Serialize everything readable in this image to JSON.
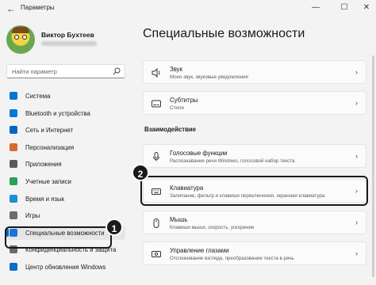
{
  "window": {
    "title": "Параметры",
    "back_icon": "arrow-left-icon",
    "minimize_glyph": "—",
    "maximize_glyph": "☐",
    "close_glyph": "✕"
  },
  "profile": {
    "name": "Виктор Бухтеев"
  },
  "search": {
    "placeholder": "Найти параметр"
  },
  "sidebar": {
    "items": [
      {
        "label": "Система",
        "icon": "monitor-icon",
        "color": "#0078d4"
      },
      {
        "label": "Bluetooth и устройства",
        "icon": "bluetooth-icon",
        "color": "#0078d4"
      },
      {
        "label": "Сеть и Интернет",
        "icon": "wifi-icon",
        "color": "#0067c0"
      },
      {
        "label": "Персонализация",
        "icon": "brush-icon",
        "color": "#d86a2b"
      },
      {
        "label": "Приложения",
        "icon": "apps-icon",
        "color": "#5a5a5a"
      },
      {
        "label": "Учетные записи",
        "icon": "account-icon",
        "color": "#2e9e5b"
      },
      {
        "label": "Время и язык",
        "icon": "globe-icon",
        "color": "#1d8fd6"
      },
      {
        "label": "Игры",
        "icon": "gamepad-icon",
        "color": "#6c6c6c"
      },
      {
        "label": "Специальные возможности",
        "icon": "accessibility-icon",
        "color": "#1c74d9"
      },
      {
        "label": "Конфиденциальность и защита",
        "icon": "shield-icon",
        "color": "#6b6b6b"
      },
      {
        "label": "Центр обновления Windows",
        "icon": "update-icon",
        "color": "#0a6fc2"
      }
    ],
    "active_index": 8
  },
  "main": {
    "title": "Специальные возможности",
    "cards_top": [
      {
        "title": "Звук",
        "subtitle": "Моно звук, звуковые уведомления",
        "icon": "speaker-icon"
      },
      {
        "title": "Субтитры",
        "subtitle": "Стили",
        "icon": "captions-icon"
      }
    ],
    "section": "Взаимодействие",
    "cards_interaction": [
      {
        "title": "Голосовые функции",
        "subtitle": "Распознавание речи Windows, голосовой набор текста",
        "icon": "microphone-icon"
      },
      {
        "title": "Клавиатура",
        "subtitle": "Залипание, фильтр и клавиши переключения, экранная клавиатура",
        "icon": "keyboard-icon"
      },
      {
        "title": "Мышь",
        "subtitle": "Клавиши мыши, скорость, ускорение",
        "icon": "mouse-icon"
      },
      {
        "title": "Управление глазами",
        "subtitle": "Отслеживание взгляда, преобразование текста в речь",
        "icon": "eye-control-icon"
      }
    ]
  },
  "annotations": {
    "step1": "1",
    "step2": "2"
  },
  "colors": {
    "accent": "#0067c0",
    "background": "#f3f3f3",
    "card": "#fbfbfb"
  }
}
